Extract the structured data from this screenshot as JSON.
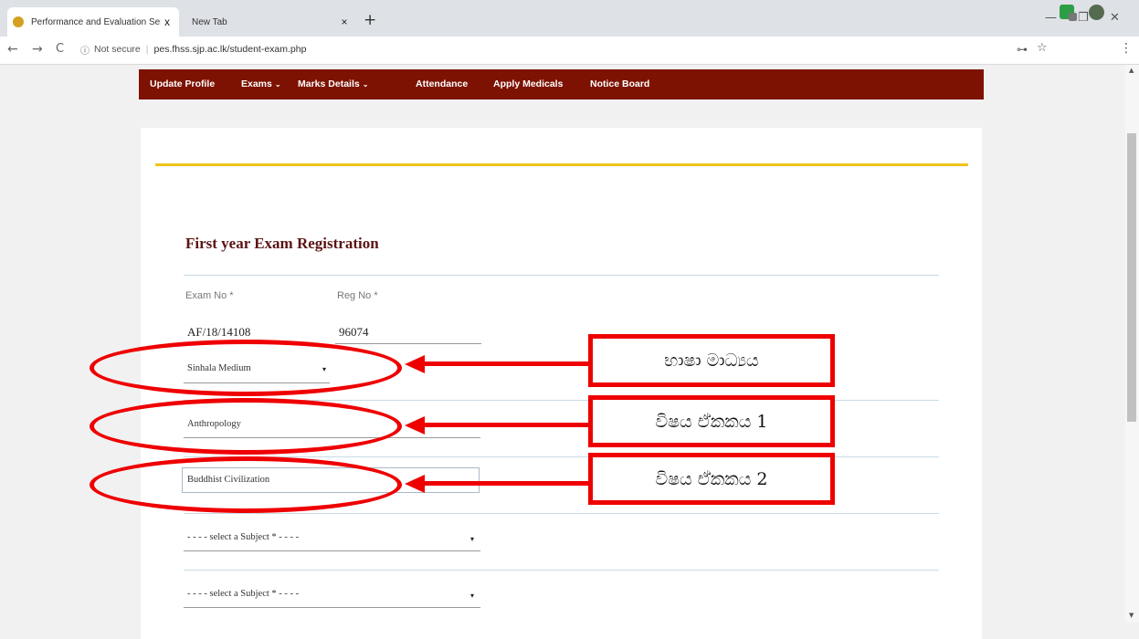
{
  "browser": {
    "tabs": [
      {
        "title": "Performance and Evaluation Serv",
        "close": "x"
      },
      {
        "title": "New Tab",
        "close": "×"
      }
    ],
    "new_tab": "+",
    "window_controls": {
      "minimize": "—",
      "maximize": "❐",
      "close": "✕"
    },
    "nav": {
      "back": "←",
      "forward": "→",
      "reload": "C"
    },
    "address": {
      "security": "Not secure",
      "url": "pes.fhss.sjp.ac.lk/student-exam.php"
    },
    "toolbar_icons": {
      "key": "⊶",
      "star": "☆",
      "menu": "⋮"
    }
  },
  "navbar": {
    "items": [
      "Update Profile",
      "Exams",
      "Marks Details",
      "Attendance",
      "Apply Medicals",
      "Notice Board"
    ],
    "caret": "⌄",
    "color": "#7d1202"
  },
  "form": {
    "title": "First year Exam Registration",
    "exam_no_label": "Exam No *",
    "reg_no_label": "Reg No *",
    "exam_no": "AF/18/14108",
    "reg_no": "96074",
    "medium": "Sinhala Medium",
    "subject1": "Anthropology",
    "subject2": "Buddhist Civilization",
    "subject_placeholder": "- - - - select a Subject * - - - -",
    "caret": "▾",
    "gold_accent": "#f0c419"
  },
  "annotations": {
    "color": "#ef0000",
    "labels": [
      "භාෂා මාධ්‍යය",
      "විෂය ඒකකය 1",
      "විෂය ඒකකය 2"
    ]
  },
  "scrollbar": {
    "up": "▲",
    "down": "▼"
  }
}
